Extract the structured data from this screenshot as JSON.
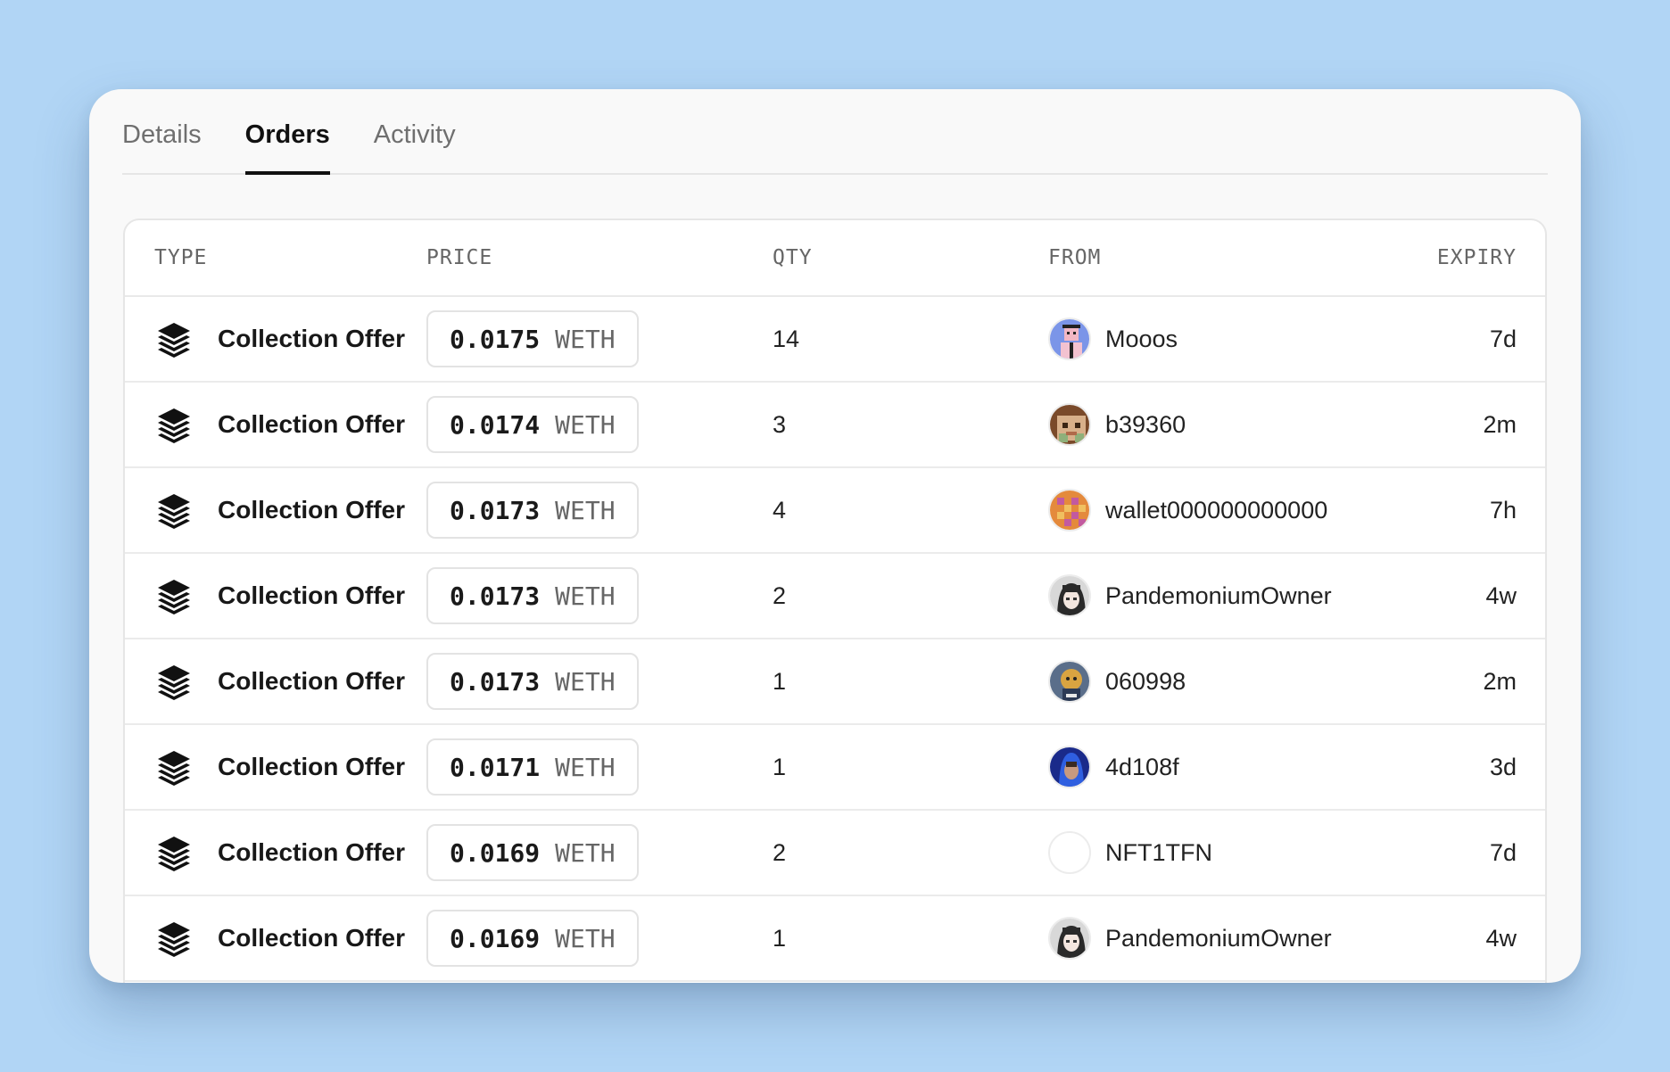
{
  "tabs": [
    {
      "label": "Details",
      "active": false
    },
    {
      "label": "Orders",
      "active": true
    },
    {
      "label": "Activity",
      "active": false
    }
  ],
  "table": {
    "headers": {
      "type": "TYPE",
      "price": "PRICE",
      "qty": "QTY",
      "from": "FROM",
      "expiry": "EXPIRY"
    },
    "rows": [
      {
        "type": "Collection Offer",
        "price": "0.0175",
        "currency": "WETH",
        "qty": "14",
        "from": "Mooos",
        "avatar": "avatar-pink-character",
        "expiry": "7d"
      },
      {
        "type": "Collection Offer",
        "price": "0.0174",
        "currency": "WETH",
        "qty": "3",
        "from": "b39360",
        "avatar": "avatar-brown-pixel",
        "expiry": "2m"
      },
      {
        "type": "Collection Offer",
        "price": "0.0173",
        "currency": "WETH",
        "qty": "4",
        "from": "wallet000000000000",
        "avatar": "avatar-orange-pixel",
        "expiry": "7h"
      },
      {
        "type": "Collection Offer",
        "price": "0.0173",
        "currency": "WETH",
        "qty": "2",
        "from": "PandemoniumOwner",
        "avatar": "avatar-anime-girl",
        "expiry": "4w"
      },
      {
        "type": "Collection Offer",
        "price": "0.0173",
        "currency": "WETH",
        "qty": "1",
        "from": "060998",
        "avatar": "avatar-gold-character",
        "expiry": "2m"
      },
      {
        "type": "Collection Offer",
        "price": "0.0171",
        "currency": "WETH",
        "qty": "1",
        "from": "4d108f",
        "avatar": "avatar-blue-hood",
        "expiry": "3d"
      },
      {
        "type": "Collection Offer",
        "price": "0.0169",
        "currency": "WETH",
        "qty": "2",
        "from": "NFT1TFN",
        "avatar": "avatar-empty",
        "expiry": "7d"
      },
      {
        "type": "Collection Offer",
        "price": "0.0169",
        "currency": "WETH",
        "qty": "1",
        "from": "PandemoniumOwner",
        "avatar": "avatar-anime-girl",
        "expiry": "4w"
      }
    ]
  },
  "colors": {
    "background": "#b1d5f5",
    "card": "#f9f9f9",
    "accent": "#111111"
  }
}
